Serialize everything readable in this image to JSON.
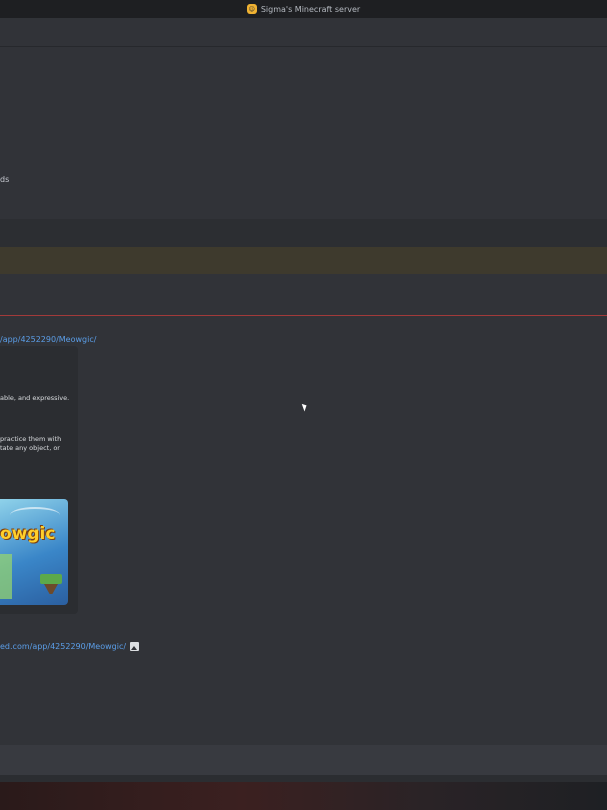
{
  "window": {
    "title": "Sigma's Minecraft server",
    "server_icon": "server-icon"
  },
  "messages": {
    "fragment_1": "ds",
    "link_1": "/app/4252290/Meowgic/",
    "embed": {
      "line_1": "able, and expressive.",
      "line_2": "practice them with",
      "line_3": "tate any object, or",
      "thumbnail_logo": "owgic"
    },
    "link_2": "ed.com/app/4252290/Meowgic/",
    "image_icon": "image-icon"
  },
  "colors": {
    "background": "#313338",
    "titlebar": "#1e1f22",
    "link": "#5b9ee8",
    "highlight": "#3e3a2d",
    "new_messages_divider": "#a23a3a"
  }
}
